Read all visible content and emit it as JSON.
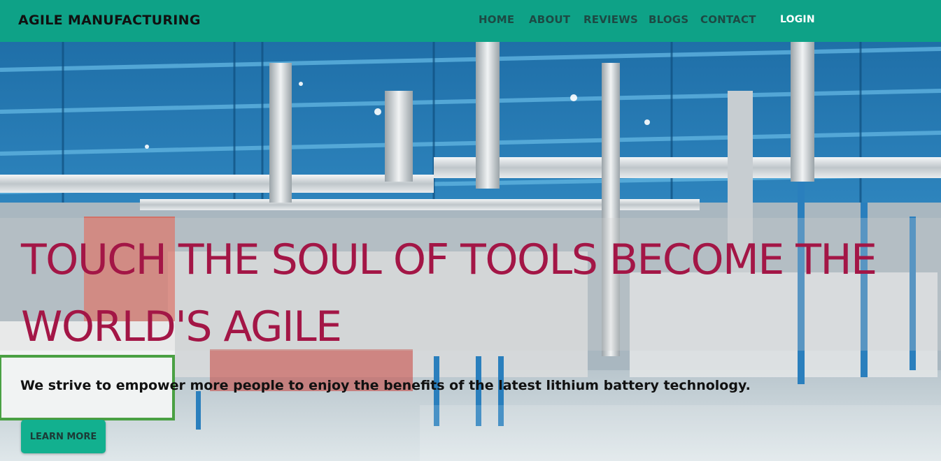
{
  "header": {
    "brand": "AGILE MANUFACTURING",
    "nav": [
      "HOME",
      "ABOUT",
      "REVIEWS",
      "BLOGS",
      "CONTACT"
    ],
    "login": "LOGIN"
  },
  "hero": {
    "headline": "TOUCH THE SOUL OF TOOLS BECOME THE WORLD'S AGILE",
    "subline": "We strive to empower more people to enjoy the benefits of the latest lithium battery technology.",
    "cta": "LEARN MORE",
    "image": "factory-interior-photo"
  },
  "colors": {
    "header_bg": "#0ea287",
    "headline": "#a31646",
    "button_bg": "#12b08f"
  }
}
